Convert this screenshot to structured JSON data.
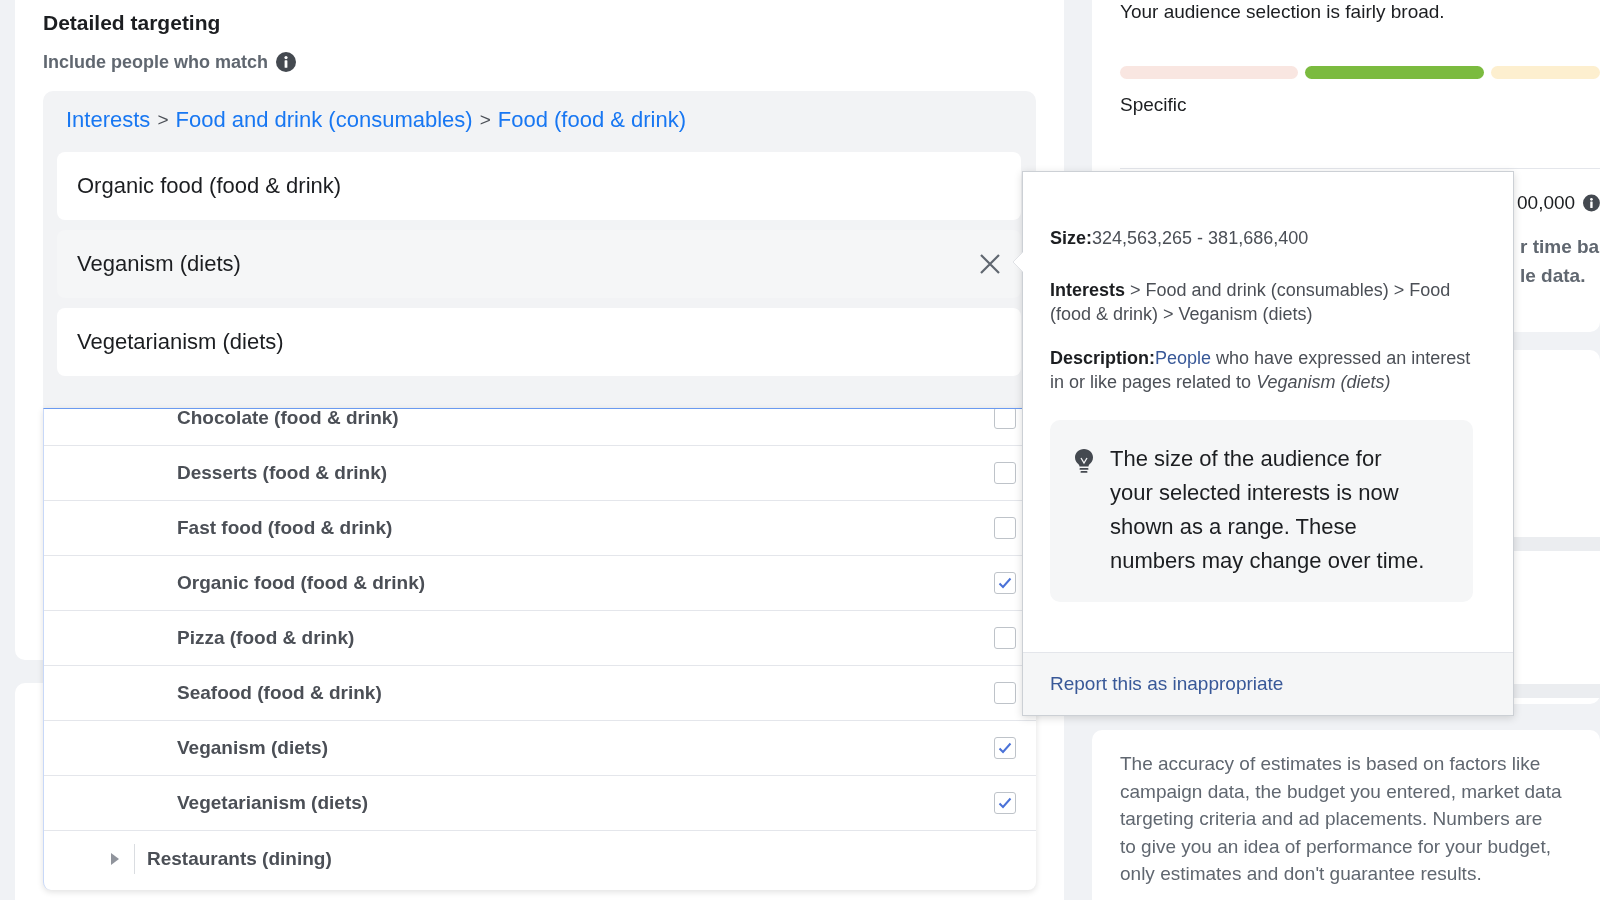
{
  "detailed_targeting": {
    "title": "Detailed targeting",
    "subtitle": "Include people who match",
    "breadcrumb": {
      "links": [
        "Interests",
        "Food and drink (consumables)",
        "Food (food & drink)"
      ],
      "separator": ">"
    },
    "selected_interests": [
      {
        "label": "Organic food (food & drink)",
        "hovered": false
      },
      {
        "label": "Veganism (diets)",
        "hovered": true
      },
      {
        "label": "Vegetarianism (diets)",
        "hovered": false
      }
    ]
  },
  "dropdown": {
    "options": [
      {
        "label": "Chocolate (food & drink)",
        "checked": false
      },
      {
        "label": "Desserts (food & drink)",
        "checked": false
      },
      {
        "label": "Fast food (food & drink)",
        "checked": false
      },
      {
        "label": "Organic food (food & drink)",
        "checked": true
      },
      {
        "label": "Pizza (food & drink)",
        "checked": false
      },
      {
        "label": "Seafood (food & drink)",
        "checked": false
      },
      {
        "label": "Veganism (diets)",
        "checked": true
      },
      {
        "label": "Vegetarianism (diets)",
        "checked": true
      }
    ],
    "category": {
      "label": "Restaurants (dining)",
      "expanded": false
    }
  },
  "tooltip": {
    "size": "**Size:**324,563,265 - 381,686,400",
    "path": "**Interests** > Food and drink (consumables) > Food (food & drink) > Veganism (diets)",
    "description_label": "Description:",
    "description_link": "People",
    "description_rest": " who have expressed an interest in or like pages related to *Veganism (diets)*",
    "tip": "The size of the audience for your selected interests is now shown as a range. These numbers may change over time.",
    "report_link": "Report this as inappropriate"
  },
  "audience": {
    "breadth": "Your audience selection is fairly broad.",
    "meter": [
      {
        "color": "#f9e6e1"
      },
      {
        "color": "#7bbb3f"
      },
      {
        "color": "#fdefcf"
      }
    ],
    "meter_label": "Specific",
    "estimate": "00,000",
    "note_lines": [
      "r time ba",
      "le data."
    ],
    "accuracy_lines": [
      "The accuracy of estimates is based on factors like",
      "campaign data, the budget you entered, market data",
      "targeting criteria and ad placements. Numbers are",
      "to give you an idea of performance for your budget,",
      "only estimates and don't guarantee results."
    ]
  }
}
